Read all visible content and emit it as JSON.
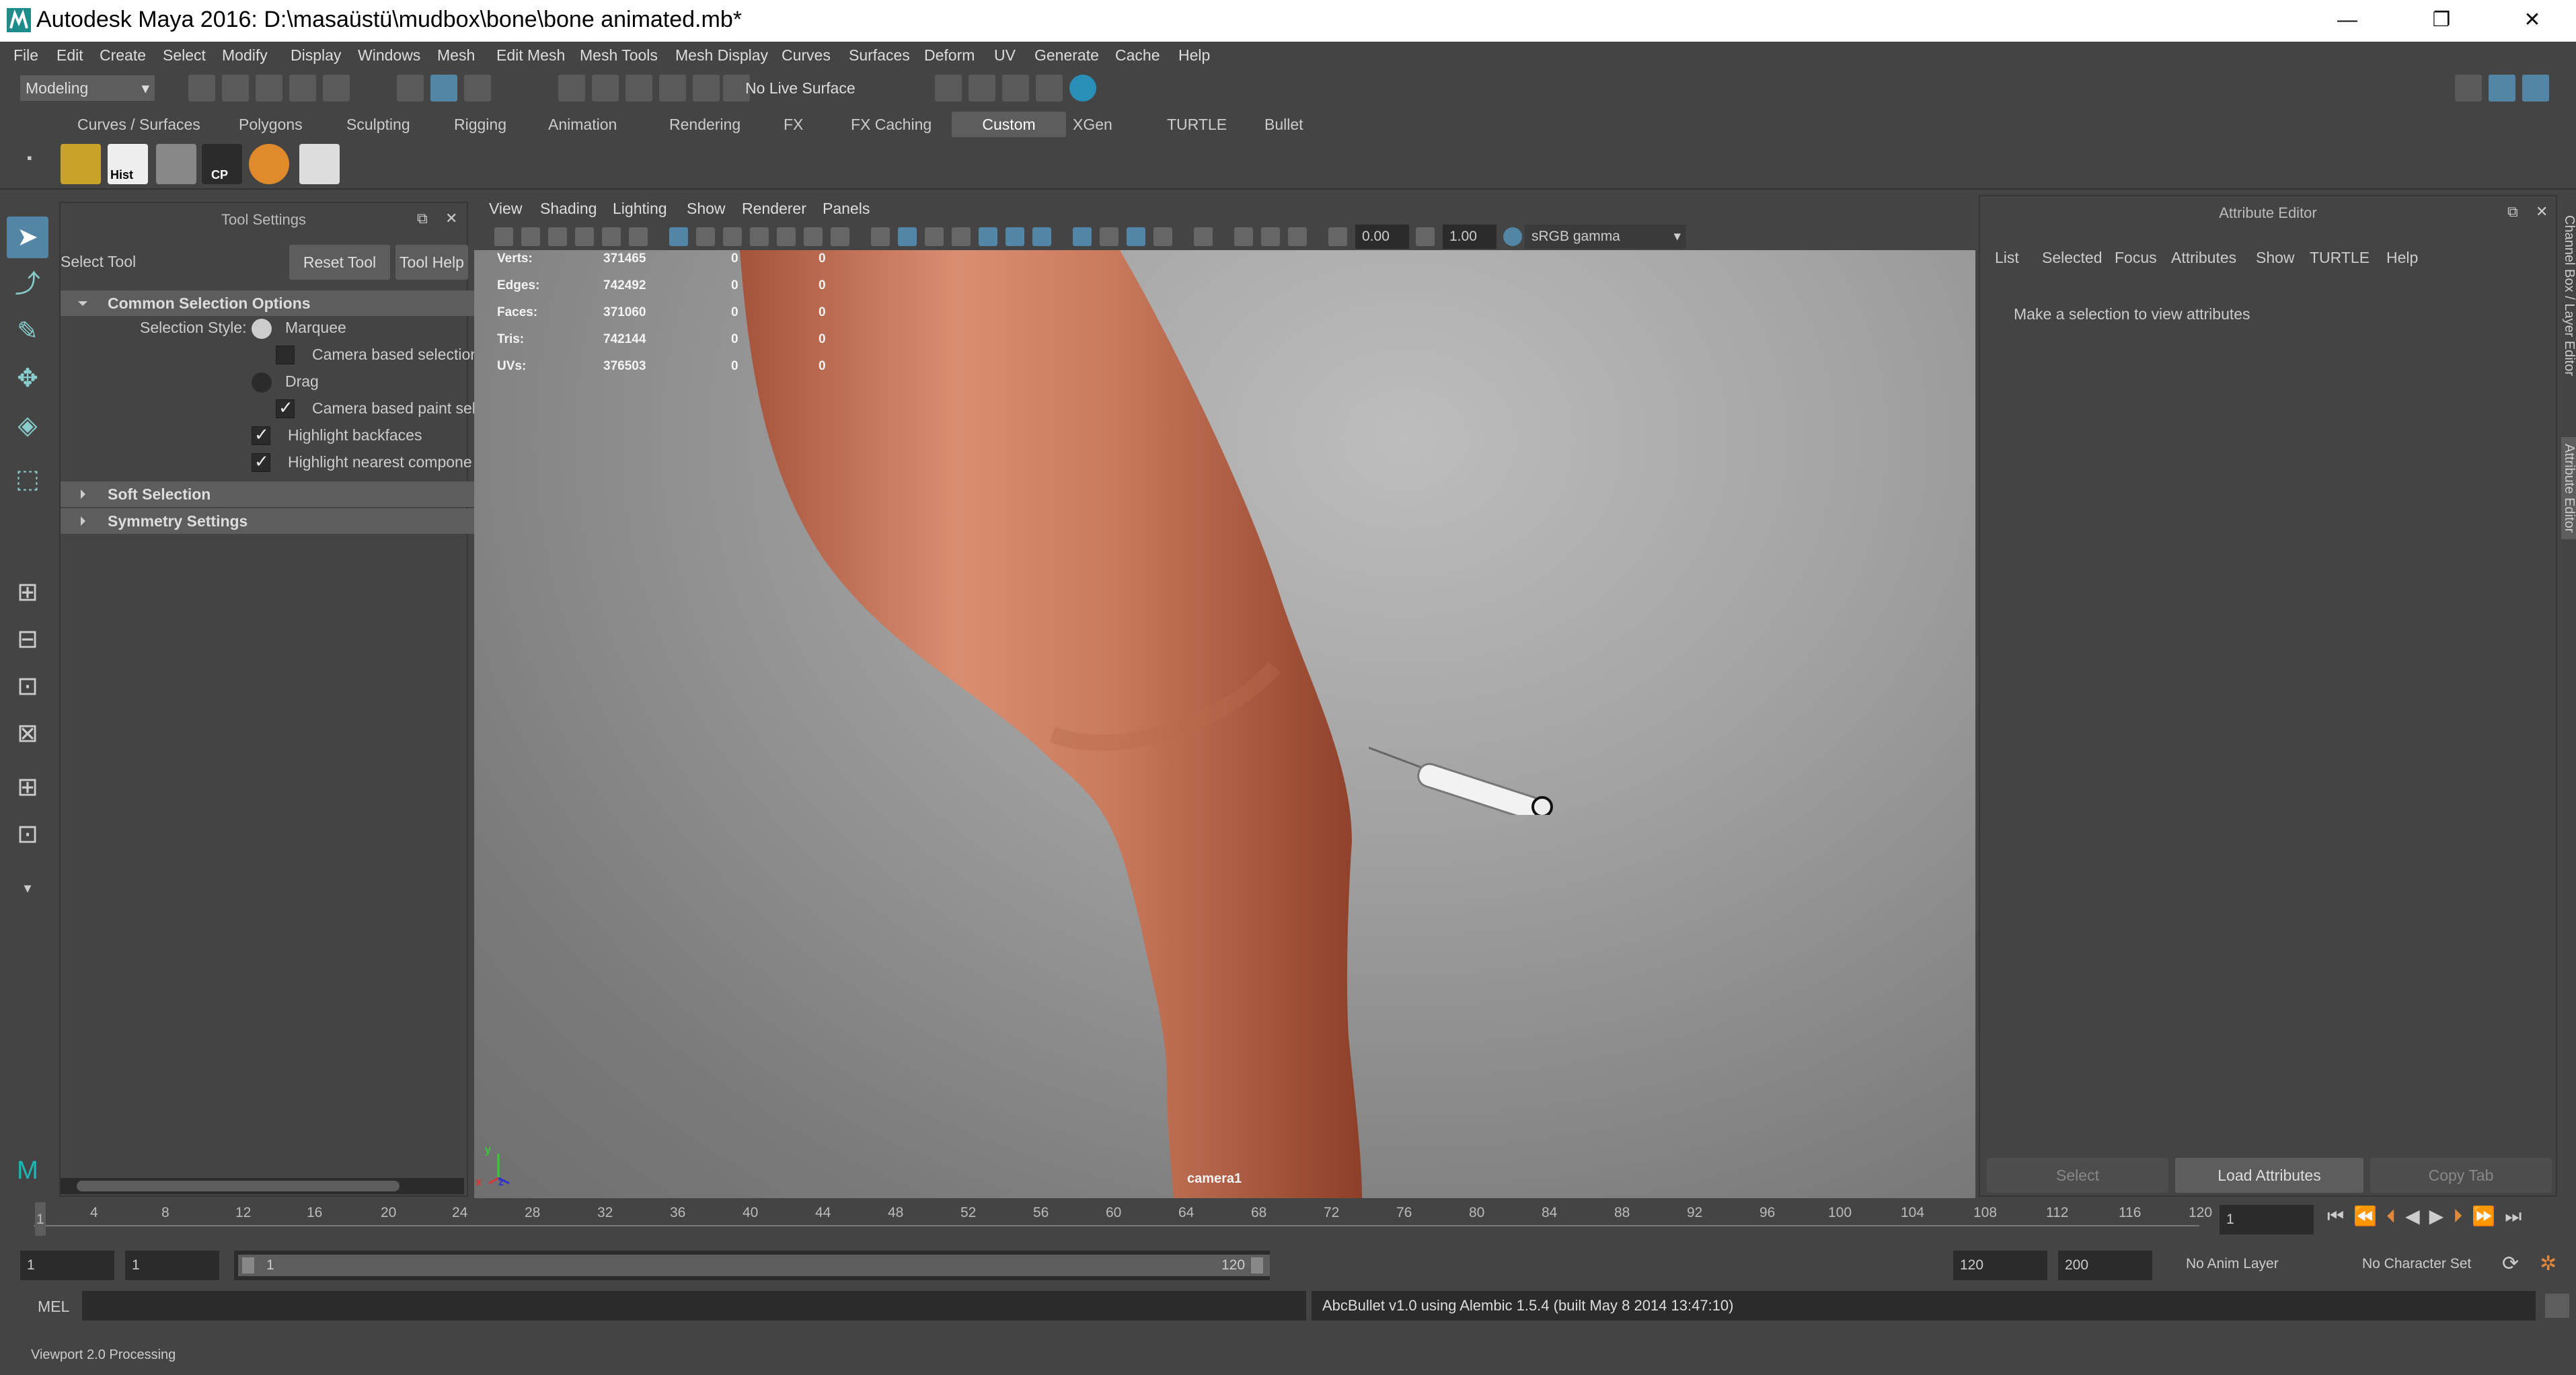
{
  "window": {
    "title": "Autodesk Maya 2016: D:\\masaüstü\\mudbox\\bone\\bone animated.mb*",
    "minimize": "—",
    "restore": "❐",
    "close": "✕"
  },
  "menu": [
    "File",
    "Edit",
    "Create",
    "Select",
    "Modify",
    "Display",
    "Windows",
    "Mesh",
    "Edit Mesh",
    "Mesh Tools",
    "Mesh Display",
    "Curves",
    "Surfaces",
    "Deform",
    "UV",
    "Generate",
    "Cache",
    "Help"
  ],
  "toolbar": {
    "mode": "Modeling",
    "live_surface": "No Live Surface"
  },
  "shelf_tabs": [
    "Curves / Surfaces",
    "Polygons",
    "Sculpting",
    "Rigging",
    "Animation",
    "Rendering",
    "FX",
    "FX Caching",
    "Custom",
    "XGen",
    "TURTLE",
    "Bullet"
  ],
  "shelf_active": "Custom",
  "shelf_labels": {
    "hist": "Hist",
    "cp": "CP"
  },
  "tool_settings": {
    "title": "Tool Settings",
    "tool": "Select Tool",
    "reset": "Reset Tool",
    "help": "Tool Help",
    "common": "Common Selection Options",
    "style_label": "Selection Style:",
    "marquee": "Marquee",
    "camera_sel": "Camera based selection",
    "drag": "Drag",
    "camera_paint": "Camera based paint sel",
    "backfaces": "Highlight backfaces",
    "nearest": "Highlight nearest compone",
    "soft": "Soft Selection",
    "symmetry": "Symmetry Settings"
  },
  "viewport": {
    "menu": [
      "View",
      "Shading",
      "Lighting",
      "Show",
      "Renderer",
      "Panels"
    ],
    "exposure": "0.00",
    "gamma": "1.00",
    "colorspace": "sRGB gamma",
    "camera": "camera1",
    "hud": [
      {
        "label": "Verts:",
        "a": "371465",
        "b": "0",
        "c": "0"
      },
      {
        "label": "Edges:",
        "a": "742492",
        "b": "0",
        "c": "0"
      },
      {
        "label": "Faces:",
        "a": "371060",
        "b": "0",
        "c": "0"
      },
      {
        "label": "Tris:",
        "a": "742144",
        "b": "0",
        "c": "0"
      },
      {
        "label": "UVs:",
        "a": "376503",
        "b": "0",
        "c": "0"
      }
    ],
    "axis": {
      "x": "x",
      "y": "y",
      "z": "z"
    }
  },
  "attribute_editor": {
    "title": "Attribute Editor",
    "menu": [
      "List",
      "Selected",
      "Focus",
      "Attributes",
      "Show",
      "TURTLE",
      "Help"
    ],
    "message": "Make a selection to view attributes",
    "select": "Select",
    "load": "Load Attributes",
    "copy": "Copy Tab",
    "side_tabs": {
      "channel": "Channel Box / Layer Editor",
      "attr": "Attribute Editor"
    }
  },
  "timeline": {
    "ticks": [
      "1",
      "4",
      "8",
      "12",
      "16",
      "20",
      "24",
      "28",
      "32",
      "36",
      "40",
      "44",
      "48",
      "52",
      "56",
      "60",
      "64",
      "68",
      "72",
      "76",
      "80",
      "84",
      "88",
      "92",
      "96",
      "100",
      "104",
      "108",
      "112",
      "116",
      "120"
    ],
    "current": "1"
  },
  "range": {
    "start": "1",
    "anim_start": "1",
    "slider_start": "1",
    "slider_end": "120",
    "end": "120",
    "anim_end": "200",
    "anim_layer": "No Anim Layer",
    "char_set": "No Character Set"
  },
  "command": {
    "lang": "MEL",
    "result": "AbcBullet v1.0 using Alembic 1.5.4 (built May  8 2014 13:47:10)"
  },
  "status": "Viewport 2.0 Processing"
}
